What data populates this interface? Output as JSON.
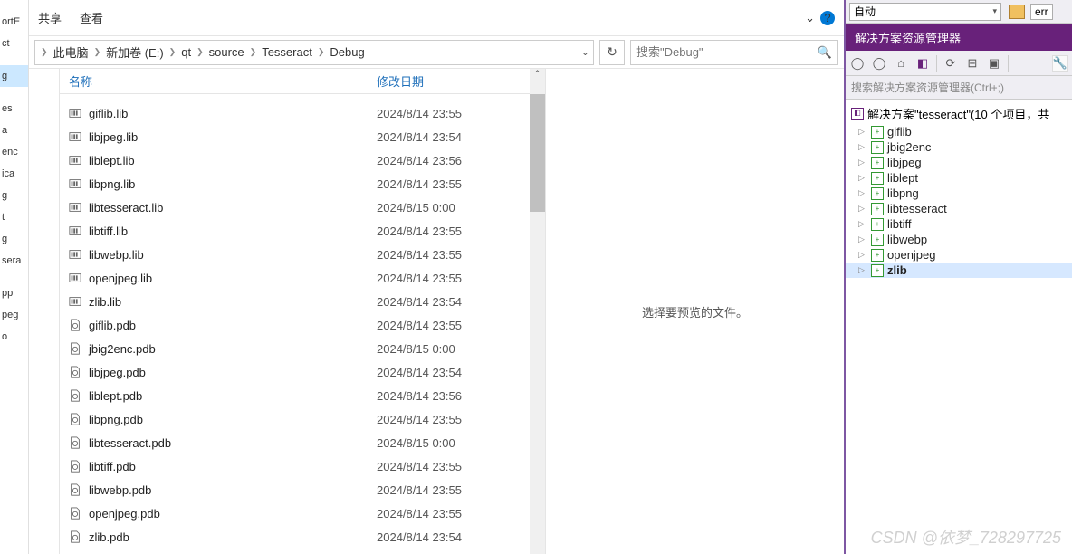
{
  "toolbar": {
    "share": "共享",
    "view": "查看"
  },
  "breadcrumbs": [
    "此电脑",
    "新加卷 (E:)",
    "qt",
    "source",
    "Tesseract",
    "Debug"
  ],
  "search": {
    "placeholder": "搜索\"Debug\""
  },
  "columns": {
    "name": "名称",
    "modified": "修改日期"
  },
  "files": [
    {
      "icon": "lib",
      "name": "giflib.lib",
      "date": "2024/8/14 23:55"
    },
    {
      "icon": "lib",
      "name": "libjpeg.lib",
      "date": "2024/8/14 23:54"
    },
    {
      "icon": "lib",
      "name": "liblept.lib",
      "date": "2024/8/14 23:56"
    },
    {
      "icon": "lib",
      "name": "libpng.lib",
      "date": "2024/8/14 23:55"
    },
    {
      "icon": "lib",
      "name": "libtesseract.lib",
      "date": "2024/8/15 0:00"
    },
    {
      "icon": "lib",
      "name": "libtiff.lib",
      "date": "2024/8/14 23:55"
    },
    {
      "icon": "lib",
      "name": "libwebp.lib",
      "date": "2024/8/14 23:55"
    },
    {
      "icon": "lib",
      "name": "openjpeg.lib",
      "date": "2024/8/14 23:55"
    },
    {
      "icon": "lib",
      "name": "zlib.lib",
      "date": "2024/8/14 23:54"
    },
    {
      "icon": "pdb",
      "name": "giflib.pdb",
      "date": "2024/8/14 23:55"
    },
    {
      "icon": "pdb",
      "name": "jbig2enc.pdb",
      "date": "2024/8/15 0:00"
    },
    {
      "icon": "pdb",
      "name": "libjpeg.pdb",
      "date": "2024/8/14 23:54"
    },
    {
      "icon": "pdb",
      "name": "liblept.pdb",
      "date": "2024/8/14 23:56"
    },
    {
      "icon": "pdb",
      "name": "libpng.pdb",
      "date": "2024/8/14 23:55"
    },
    {
      "icon": "pdb",
      "name": "libtesseract.pdb",
      "date": "2024/8/15 0:00"
    },
    {
      "icon": "pdb",
      "name": "libtiff.pdb",
      "date": "2024/8/14 23:55"
    },
    {
      "icon": "pdb",
      "name": "libwebp.pdb",
      "date": "2024/8/14 23:55"
    },
    {
      "icon": "pdb",
      "name": "openjpeg.pdb",
      "date": "2024/8/14 23:55"
    },
    {
      "icon": "pdb",
      "name": "zlib.pdb",
      "date": "2024/8/14 23:54"
    }
  ],
  "preview": {
    "empty": "选择要预览的文件。"
  },
  "left_nav": [
    "",
    "ortE",
    "ct",
    "",
    "g",
    "",
    "es",
    "a",
    "enc",
    "ica",
    "g",
    "t",
    "g",
    "sera",
    "",
    "pp",
    "peg",
    "o",
    ""
  ],
  "vs": {
    "config": "自动",
    "errbox": "err",
    "panel_title": "解决方案资源管理器",
    "search_placeholder": "搜索解决方案资源管理器(Ctrl+;)",
    "solution": "解决方案\"tesseract\"(10 个项目，共",
    "projects": [
      "giflib",
      "jbig2enc",
      "libjpeg",
      "liblept",
      "libpng",
      "libtesseract",
      "libtiff",
      "libwebp",
      "openjpeg",
      "zlib"
    ],
    "selected": "zlib"
  },
  "watermark": "CSDN @依梦_728297725"
}
